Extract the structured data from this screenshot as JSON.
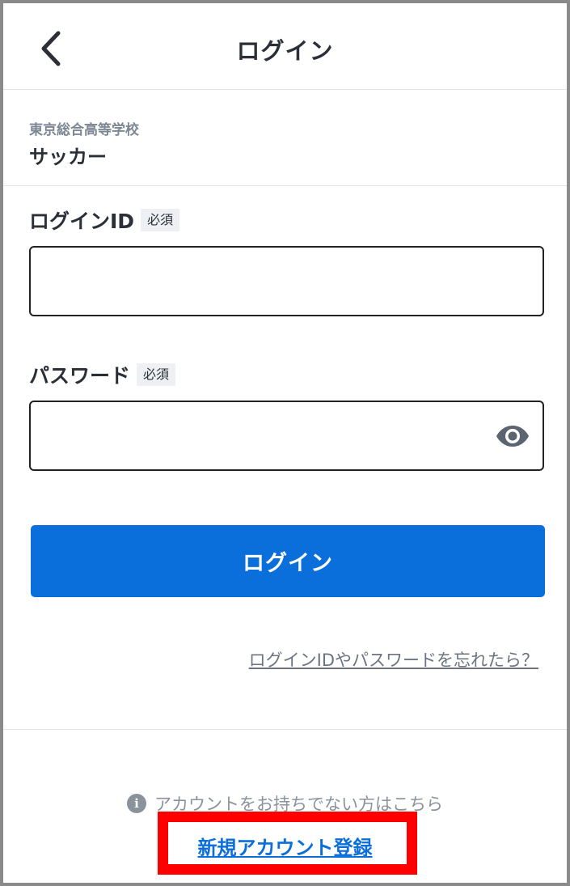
{
  "header": {
    "title": "ログイン",
    "back_icon": "chevron-left-icon"
  },
  "school": {
    "name": "東京総合高等学校",
    "team": "サッカー"
  },
  "form": {
    "login_id": {
      "label": "ログインID",
      "required_badge": "必須",
      "value": ""
    },
    "password": {
      "label": "パスワード",
      "required_badge": "必須",
      "value": "",
      "toggle_icon": "eye-icon"
    },
    "submit_label": "ログイン",
    "forgot_link": "ログインIDやパスワードを忘れたら？"
  },
  "footer": {
    "info_icon": "info-icon",
    "no_account_text": "アカウントをお持ちでない方はこちら",
    "register_link": "新規アカウント登録"
  },
  "colors": {
    "primary": "#0b6fdb",
    "highlight": "#ff0000",
    "muted": "#8a929c"
  }
}
